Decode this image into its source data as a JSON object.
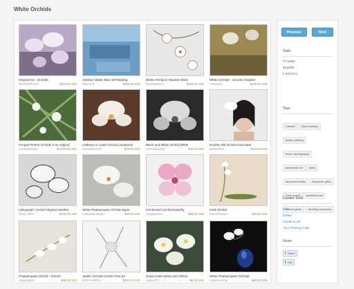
{
  "page": {
    "title": "White Orchids"
  },
  "items": [
    {
      "title": "Original Art - Orchids",
      "shop": "TeaTimeFineArt",
      "price": "$400.00 USD"
    },
    {
      "title": "Abstract Water Blue Oil Painting",
      "shop": "HDonnelli",
      "price": "$285.25 USD"
    },
    {
      "title": "White Orchid in Stained Glass",
      "shop": "GlassWashCo",
      "price": "$160.00 USD"
    },
    {
      "title": "White Orchids - 11x14in Original",
      "shop": "Amidoose",
      "price": "$149.95 USD"
    },
    {
      "title": "Fringed Prairie Orchids II an original",
      "shop": "meanthebesss",
      "price": "$2,000.00 USD"
    },
    {
      "title": "Cattleya or Laelia Orchid Lampwork",
      "shop": "HannahRachel",
      "price": "$75.00 USD"
    },
    {
      "title": "Black and White Orchid-White",
      "shop": "carlenatravishi",
      "price": "$25.00 USD"
    },
    {
      "title": "Double Silk Orchid Fascinator",
      "shop": "pishposhes",
      "price": "$118.00 USD"
    },
    {
      "title": "Lithograph: Orchid Original Heather",
      "shop": "LibraryofKel",
      "price": "$130.00 USD"
    },
    {
      "title": "White Phalaenopsis Orchid Hyper",
      "shop": "LeBlossomStudio",
      "price": "$65.00 USD"
    },
    {
      "title": "Felt brooch Orchid-butterfly",
      "shop": "OrigaNotions",
      "price": "$39.00 USD"
    },
    {
      "title": "moth Orchid",
      "shop": "DesertCanyon",
      "price": "$39.00 USD"
    },
    {
      "title": "Phalaenopsis Orchid - French",
      "shop": "copperglass",
      "price": "$65.00 USD"
    },
    {
      "title": "Spider Orchids Giclee Print 24",
      "shop": "MARTHAROS",
      "price": "$750.00 USD"
    },
    {
      "title": "Hand-made White and Yellow",
      "shop": "AppleNYC",
      "price": "$9.00 USD"
    },
    {
      "title": "White Phalaenopsis Orchids",
      "shop": "LupaloveGrap",
      "price": "$65.00 USD"
    }
  ],
  "sidebar": {
    "previous_label": "Previous",
    "next_label": "Next",
    "stats_title": "Stats",
    "views": "77 views",
    "picks": "22 picks",
    "admirers": "5 admirers",
    "tags_title": "Tags",
    "tags": [
      "cattleya",
      "floral painting",
      "flower painting",
      "flower photography",
      "handmade art",
      "laelia",
      "lampwork beads",
      "lampwork glass",
      "moth orchid",
      "phalaenopsis",
      "stained glass",
      "wedding accessory"
    ],
    "curator_title": "Curator Tools",
    "tools": [
      "Edit",
      "Delete",
      "Create a List",
      "Your Treasury Lists"
    ],
    "share_title": "Share",
    "tweet_label": "Tweet",
    "like_label": "Like"
  },
  "colors": {
    "accent": "#5aa8d8",
    "price": "#6a9a3a",
    "link": "#3a7cc1"
  }
}
